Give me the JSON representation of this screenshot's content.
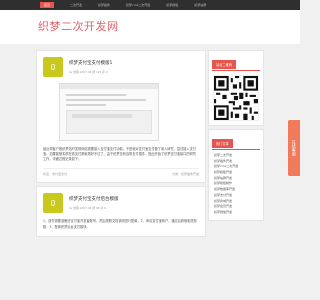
{
  "nav": {
    "items": [
      "首页",
      "二次开发",
      "织梦插件",
      "织梦cms二次开发",
      "织梦模板",
      "织梦站群"
    ],
    "active_index": 0
  },
  "site": {
    "logo": "织梦二次开发网"
  },
  "posts": [
    {
      "thumb": "0",
      "title": "织梦支付宝支付模版1",
      "info": "by 管理   2017.09   阅 125   评 0",
      "excerpt": "最近帮客户做织梦站时发现网站需要接入支付宝支付功能，于是就对支付宝支付做了深入研究，尝试接入支付宝，如果能够实现在线支付那就再好不过了。由于织梦没有自带支付插件，因此开始了织梦支付宝接口的研究工作，详细过程记录如下。",
      "tag": "标签：支付宝支付",
      "category": "分类：织梦插件开发"
    },
    {
      "thumb": "0",
      "title": "织梦支付宝支付后台模版",
      "info": "by 管理   2017.09   阅 98   评 0",
      "excerpt": "1、首先需要准备好支付宝开发者账号，然后按照文档说明进行配置，2、申请支付宝商户，通过后获取相关参数，3、配置织梦后台支付模块。",
      "tag": "",
      "category": ""
    }
  ],
  "sidebar": {
    "qr_title": "站点二维码",
    "online_label": "在线客服",
    "list_title": "热门文章",
    "list_items": [
      "织梦二次开发",
      "织梦插件开发",
      "织梦cms二次开发",
      "织梦模板开发",
      "织梦站群开发",
      "织梦模板制作",
      "织梦数据库开发",
      "织梦支付开发",
      "织梦商城开发",
      "织梦会员开发",
      "织梦微信开发"
    ]
  },
  "colors": {
    "accent": "#e8554e",
    "thumb": "#c9c91d",
    "logo": "#e0616b"
  }
}
